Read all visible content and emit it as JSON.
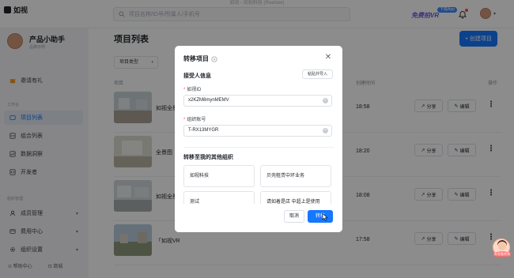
{
  "window": {
    "title": "如视 - 如视科技 (Realsee)"
  },
  "header": {
    "app_name": "如视",
    "search_placeholder": "项目名称/ID号/所属人/手机号",
    "promo_text": "免费拍VR",
    "promo_badge": "下载App"
  },
  "sidebar": {
    "profile": {
      "name": "产品小助手",
      "subtitle": "品牌示例"
    },
    "invite_label": "邀请有礼",
    "workbench_label": "工作台",
    "items": [
      {
        "label": "项目列表",
        "icon": "folder-icon",
        "active": true
      },
      {
        "label": "组合列表",
        "icon": "layers-icon",
        "active": false
      },
      {
        "label": "数据洞察",
        "icon": "chart-icon",
        "active": false
      },
      {
        "label": "开发者",
        "icon": "code-icon",
        "active": false
      }
    ],
    "org_label": "组织管理",
    "org_items": [
      {
        "label": "成员管理",
        "icon": "users-icon"
      },
      {
        "label": "费用中心",
        "icon": "wallet-icon"
      },
      {
        "label": "组织设置",
        "icon": "gear-icon"
      }
    ],
    "help_label": "帮助中心",
    "mall_label": "商城"
  },
  "main": {
    "title": "项目列表",
    "create_label": "+ 创建项目",
    "filter_label": "项目类型",
    "col_project": "项目",
    "col_created": "创建时间",
    "col_actions": "操作",
    "share_label": "分享",
    "edit_label": "编辑",
    "rows": [
      {
        "name": "如视全景",
        "time": "18:58"
      },
      {
        "name": "全景图",
        "time": "18:20"
      },
      {
        "name": "如视全景",
        "time": "18:08"
      },
      {
        "name": "「如视VR",
        "time": "17:58"
      }
    ]
  },
  "modal": {
    "title": "转移项目",
    "receiver_section": "接受人信息",
    "paste_import_label": "粘贴并导入",
    "realsee_id_label": "如视ID",
    "realsee_id_value": "x2KZM8mynMEMV",
    "org_account_label": "组织账号",
    "org_account_value": "T-RX13MYGR",
    "my_orgs_section": "转移至我的其他组织",
    "orgs": [
      "如视科技",
      "贝壳租赁中环业务",
      "测试",
      "请如着是店 中超上是使用"
    ],
    "cancel_label": "取消",
    "confirm_label": "转移"
  },
  "assistant": {
    "label": "帮我看视频"
  },
  "colors": {
    "primary": "#1677ff",
    "danger": "#ff4d4f",
    "promo": "#6c5ce7"
  }
}
